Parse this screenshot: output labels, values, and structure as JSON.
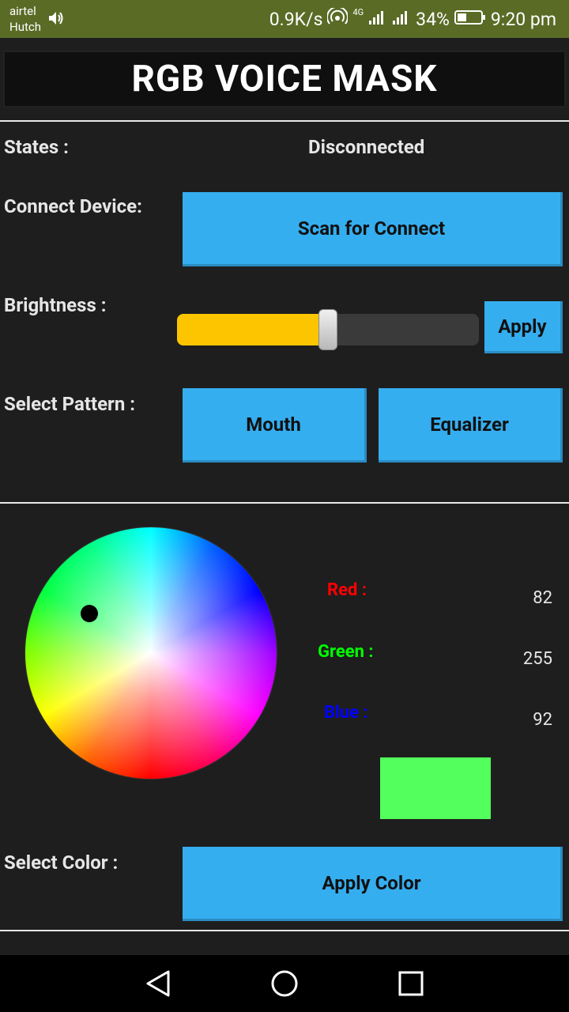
{
  "status_bar": {
    "carrier_1": "airtel",
    "carrier_2": "Hutch",
    "speed": "0.9K/s",
    "network": "4G",
    "battery": "34%",
    "time": "9:20 pm",
    "icons": [
      "volume-icon",
      "hotspot-icon",
      "signal-icon",
      "battery-icon"
    ]
  },
  "app": {
    "title": "RGB VOICE MASK"
  },
  "states": {
    "label": "States :",
    "value": "Disconnected"
  },
  "connect": {
    "label": "Connect Device:",
    "button": "Scan for Connect"
  },
  "brightness": {
    "label": "Brightness :",
    "value_fraction": 0.5,
    "apply_button": "Apply"
  },
  "pattern": {
    "label": "Select Pattern :",
    "options": [
      "Mouth",
      "Equalizer"
    ]
  },
  "color": {
    "red_label": "Red :",
    "green_label": "Green :",
    "blue_label": "Blue :",
    "red": "82",
    "green": "255",
    "blue": "92",
    "swatch_hex": "#52ff5c",
    "red_label_color": "#ff0000",
    "green_label_color": "#00ff00",
    "blue_label_color": "#0000ff"
  },
  "select_color": {
    "label": "Select Color :",
    "button": "Apply Color"
  },
  "navigation": {
    "buttons": [
      "back-icon",
      "home-icon",
      "recents-icon"
    ]
  },
  "colors": {
    "button": "#35aef0",
    "slider_fill": "#fdc500",
    "status_bar": "#5a6b26",
    "background": "#1e1e1e"
  }
}
